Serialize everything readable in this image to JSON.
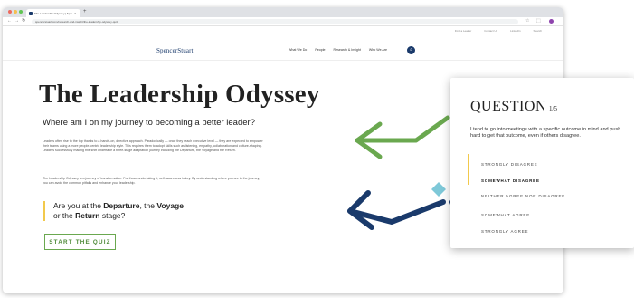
{
  "browser": {
    "tab_title": "The Leadership Odyssey | Spencer Stuart",
    "new_tab_glyph": "+",
    "tab_close_glyph": "×",
    "url": "spencerstuart.com/research-and-insight/the-leadership-odyssey-quiz",
    "window_dot_colors": [
      "#ed6a5e",
      "#f5bf4f",
      "#61c554"
    ],
    "profile_color": "#8e44ad"
  },
  "site": {
    "utility_nav": [
      "Find a Leader",
      "Contact Us",
      "LinkedIn",
      "Search"
    ],
    "brand": "SpencerStuart",
    "main_nav": [
      "What We Do",
      "People",
      "Research & Insight",
      "Who We Are"
    ],
    "search_icon": "search-icon"
  },
  "hero": {
    "title": "The Leadership Odyssey",
    "subtitle": "Where am I on my journey to becoming a better leader?",
    "paragraph_1": "Leaders often rise to the top thanks to a hands-on, directive approach. Paradoxically — once they reach executive level — they are expected to empower their teams using a more people-centric leadership style. This requires them to adopt skills such as listening, empathy, collaboration and culture-shaping. Leaders successfully making this shift undertake a three-stage adaptation journey including the Departure, the Voyage and the Return.",
    "paragraph_2": "The Leadership Odyssey is a journey of transformation. For those undertaking it, self-awareness is key. By understanding where you are in the journey, you can avoid the common pitfalls and enhance your leadership.",
    "stage_question": {
      "prefix": "Are you at the ",
      "departure": "Departure",
      "middle": ", the ",
      "voyage": "Voyage",
      "line2_prefix": "or the ",
      "return": "Return",
      "suffix": " stage?"
    },
    "cta": "START THE QUIZ"
  },
  "quiz_card": {
    "title": "QUESTION",
    "count": "1/5",
    "question": "I tend to go into meetings with a specific outcome in mind and push hard to get that outcome, even if others disagree.",
    "options": [
      "STRONGLY DISAGREE",
      "SOMEWHAT DISAGREE",
      "NEITHER AGREE NOR DISAGREE",
      "SOMEWHAT AGREE",
      "STRONGLY AGREE"
    ],
    "selected_option": "SOMEWHAT DISAGREE"
  },
  "colors": {
    "brand_navy": "#1a3a6b",
    "arrow_green": "#6aa84f",
    "arrow_teal": "#7ec8d8",
    "highlight_yellow": "#f2c94c"
  }
}
